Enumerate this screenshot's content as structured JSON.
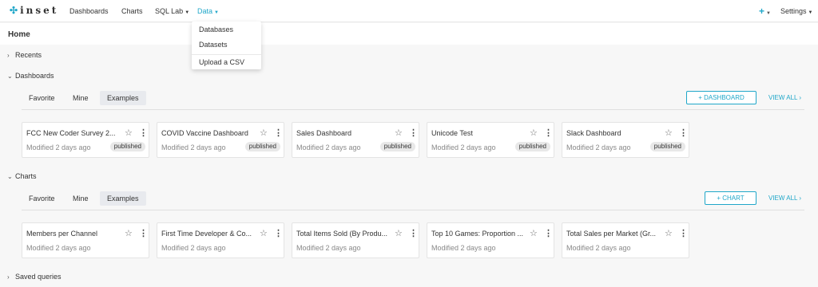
{
  "navbar": {
    "logo": "inset",
    "items": [
      {
        "label": "Dashboards"
      },
      {
        "label": "Charts"
      },
      {
        "label": "SQL Lab"
      },
      {
        "label": "Data"
      }
    ],
    "plus_label": "+",
    "settings_label": "Settings"
  },
  "data_menu": {
    "items": [
      "Databases",
      "Datasets",
      "Upload a CSV"
    ]
  },
  "home": {
    "title": "Home"
  },
  "sections": {
    "recents": {
      "label": "Recents"
    },
    "dashboards": {
      "label": "Dashboards",
      "tabs": [
        "Favorite",
        "Mine",
        "Examples"
      ],
      "create_label": "+ DASHBOARD",
      "view_all": "VIEW ALL ›",
      "cards": [
        {
          "title": "FCC New Coder Survey 2...",
          "sub": "Modified 2 days ago",
          "badge": "published"
        },
        {
          "title": "COVID Vaccine Dashboard",
          "sub": "Modified 2 days ago",
          "badge": "published"
        },
        {
          "title": "Sales Dashboard",
          "sub": "Modified 2 days ago",
          "badge": "published"
        },
        {
          "title": "Unicode Test",
          "sub": "Modified 2 days ago",
          "badge": "published"
        },
        {
          "title": "Slack Dashboard",
          "sub": "Modified 2 days ago",
          "badge": "published"
        }
      ]
    },
    "charts": {
      "label": "Charts",
      "tabs": [
        "Favorite",
        "Mine",
        "Examples"
      ],
      "create_label": "+ CHART",
      "view_all": "VIEW ALL ›",
      "cards": [
        {
          "title": "Members per Channel",
          "sub": "Modified 2 days ago"
        },
        {
          "title": "First Time Developer & Co...",
          "sub": "Modified 2 days ago"
        },
        {
          "title": "Total Items Sold (By Produ...",
          "sub": "Modified 2 days ago"
        },
        {
          "title": "Top 10 Games: Proportion ...",
          "sub": "Modified 2 days ago"
        },
        {
          "title": "Total Sales per Market (Gr...",
          "sub": "Modified 2 days ago"
        }
      ]
    },
    "saved_queries": {
      "label": "Saved queries"
    }
  },
  "colors": {
    "accent": "#20a7c9"
  }
}
